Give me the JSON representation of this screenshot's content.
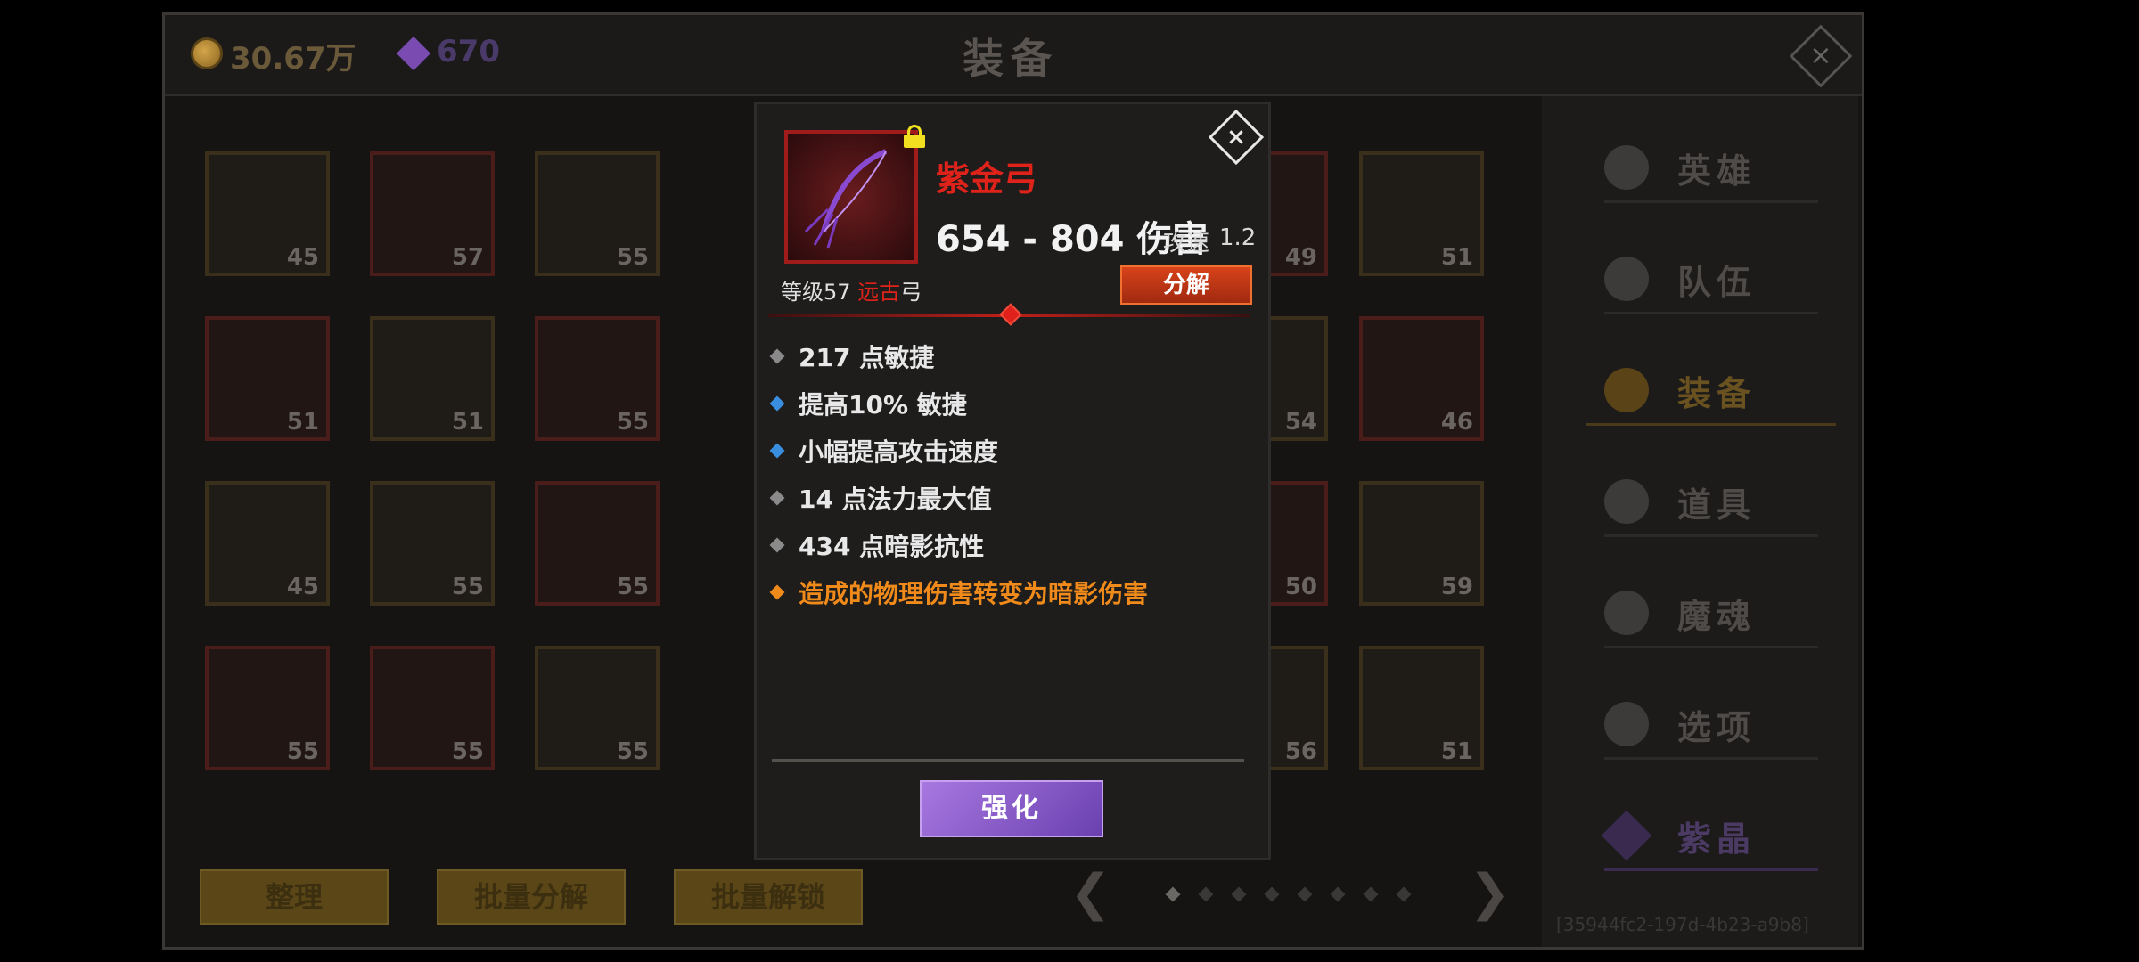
{
  "currency": {
    "gold": "30.67万",
    "gems": "670"
  },
  "title": "装备",
  "close_glyph": "×",
  "grid_levels": {
    "row1": [
      "45",
      "57",
      "55",
      "49",
      "51"
    ],
    "row2": [
      "51",
      "51",
      "55",
      "54",
      "46"
    ],
    "row3": [
      "45",
      "55",
      "55",
      "50",
      "59"
    ],
    "row4": [
      "55",
      "55",
      "55",
      "56",
      "51"
    ]
  },
  "sidebar": {
    "items": [
      {
        "label": "英雄",
        "icon": "people-icon"
      },
      {
        "label": "队伍",
        "icon": "flag-icon"
      },
      {
        "label": "装备",
        "icon": "helmet-icon"
      },
      {
        "label": "道具",
        "icon": "bag-icon"
      },
      {
        "label": "魔魂",
        "icon": "flame-icon"
      },
      {
        "label": "选项",
        "icon": "gear-icon"
      },
      {
        "label": "紫晶",
        "icon": "crystal-icon"
      }
    ]
  },
  "bottom_buttons": {
    "sort": "整理",
    "batch_decompose": "批量分解",
    "batch_unlock": "批量解锁"
  },
  "pagination": {
    "prev": "❮",
    "next": "❯"
  },
  "uid_text": "[35944fc2-197d-4b23-a9b8]",
  "item": {
    "name": "紫金弓",
    "damage": "654 - 804 伤害",
    "speed_label": "攻速",
    "speed_value": "1.2",
    "level_prefix": "等级57",
    "rarity": "远古",
    "type": "弓",
    "decompose_label": "分解",
    "enhance_label": "强化",
    "stats": [
      {
        "text": "217 点敏捷",
        "color": "#8a8a8a"
      },
      {
        "text": "提高10% 敏捷",
        "color": "#3a8ee0"
      },
      {
        "text": "小幅提高攻击速度",
        "color": "#3a8ee0"
      },
      {
        "text": "14 点法力最大值",
        "color": "#8a8a8a"
      },
      {
        "text": "434 点暗影抗性",
        "color": "#8a8a8a"
      },
      {
        "text": "造成的物理伤害转变为暗影伤害",
        "color": "#f08a1a"
      }
    ]
  },
  "colors": {
    "rarity": "#e0231a",
    "legendary_stat": "#f08a1a"
  }
}
